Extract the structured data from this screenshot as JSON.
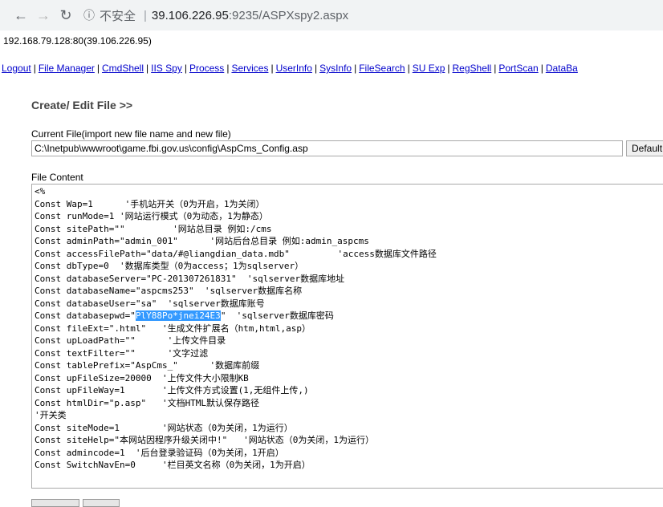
{
  "browser": {
    "back_icon": "arrow-left-icon",
    "forward_icon": "arrow-right-icon",
    "reload_icon": "reload-icon",
    "info_icon": "info-icon",
    "insecure_label": "不安全",
    "separator": "|",
    "host": "39.106.226.95",
    "path": ":9235/ASPXspy2.aspx"
  },
  "host_line": "192.168.79.128:80(39.106.226.95)",
  "nav": [
    "Logout",
    "File Manager",
    "CmdShell",
    "IIS Spy",
    "Process",
    "Services",
    "UserInfo",
    "SysInfo",
    "FileSearch",
    "SU Exp",
    "RegShell",
    "PortScan",
    "DataBa"
  ],
  "page_title": "Create/ Edit File >>",
  "current_file_label": "Current File(import new file name and new file)",
  "current_file_value": "C:\\Inetpub\\wwwroot\\game.fbi.gov.us\\config\\AspCms_Config.asp",
  "default_button": "Default",
  "file_content_label": "File Content",
  "code": {
    "l01": "<%",
    "l02": "Const Wap=1      '手机站开关（0为开启，1为关闭）",
    "l03": "Const runMode=1 '网站运行模式（0为动态，1为静态）",
    "l04": "Const sitePath=\"\"         '网站总目录 例如:/cms",
    "l05": "Const adminPath=\"admin_001\"      '网站后台总目录 例如:admin_aspcms",
    "l06": "Const accessFilePath=\"data/#@liangdian_data.mdb\"         'access数据库文件路径",
    "l07": "Const dbType=0  '数据库类型（0为access；1为sqlserver）",
    "l08": "Const databaseServer=\"PC-201307261831\"  'sqlserver数据库地址",
    "l09": "Const databaseName=\"aspcms253\"  'sqlserver数据库名称",
    "l10": "Const databaseUser=\"sa\"  'sqlserver数据库账号",
    "l11_a": "Const databasepwd=\"",
    "l11_hl": "PlY88Po*jnei24E3",
    "l11_b": "\"  'sqlserver数据库密码",
    "l12": "Const fileExt=\".html\"   '生成文件扩展名（htm,html,asp）",
    "l13": "Const upLoadPath=\"\"      '上传文件目录",
    "l14": "Const textFilter=\"\"      '文字过滤",
    "l15": "Const tablePrefix=\"AspCms_\"      '数据库前缀",
    "l16": "Const upFileSize=20000  '上传文件大小限制KB",
    "l17": "Const upFileWay=1       '上传文件方式设置(1,无组件上传,)",
    "l18": "Const htmlDir=\"p.asp\"   '文档HTML默认保存路径",
    "l19": "'开关类",
    "l20": "Const siteMode=1        '网站状态（0为关闭，1为运行）",
    "l21": "Const siteHelp=\"本网站因程序升级关闭中!\"   '网站状态（0为关闭，1为运行）",
    "l22": "Const admincode=1  '后台登录验证码（0为关闭，1开启）",
    "l23": "Const SwitchNavEn=0     '栏目英文名称（0为关闭，1为开启）"
  }
}
